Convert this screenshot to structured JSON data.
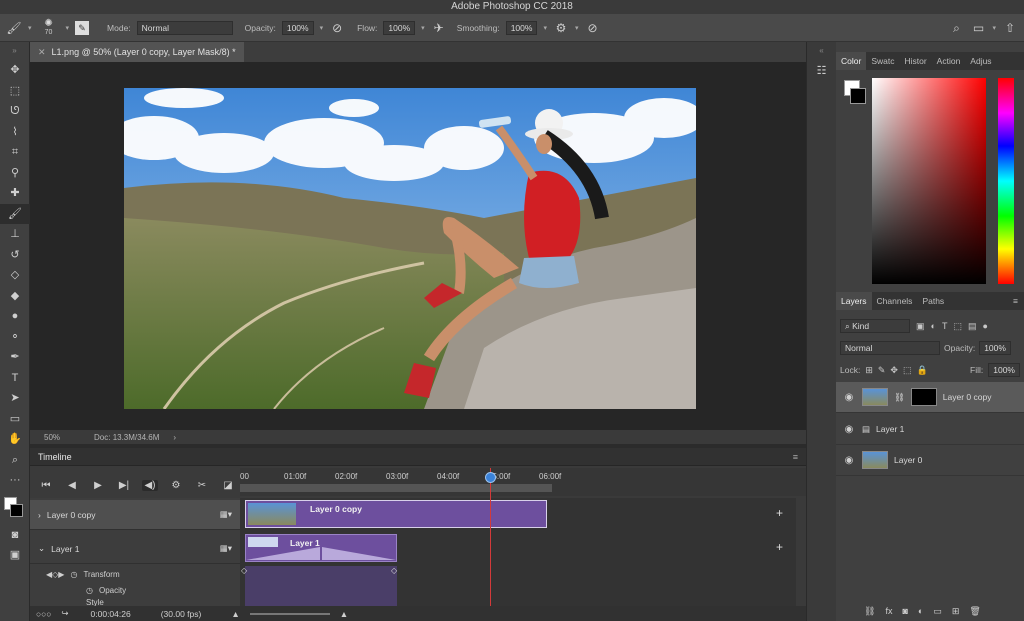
{
  "app": {
    "title": "Adobe Photoshop CC 2018"
  },
  "options": {
    "brush_size": "70",
    "mode_label": "Mode:",
    "mode_value": "Normal",
    "opacity_label": "Opacity:",
    "opacity_value": "100%",
    "flow_label": "Flow:",
    "flow_value": "100%",
    "smoothing_label": "Smoothing:",
    "smoothing_value": "100%"
  },
  "document": {
    "tab_title": "L1.png @ 50% (Layer 0 copy, Layer Mask/8) *",
    "zoom": "50%",
    "doc_size": "Doc: 13.3M/34.6M"
  },
  "timeline": {
    "title": "Timeline",
    "ruler": [
      "00",
      "01:00f",
      "02:00f",
      "03:00f",
      "04:00f",
      "05:00f",
      "06:00f"
    ],
    "tracks": [
      {
        "name": "Layer 0 copy",
        "clip": "Layer 0 copy"
      },
      {
        "name": "Layer 1",
        "clip": "Layer 1"
      }
    ],
    "sub_tracks": [
      "Transform",
      "Opacity",
      "Style"
    ],
    "timecode": "0:00:04:26",
    "fps": "(30.00 fps)",
    "playhead_seconds": 5.0
  },
  "panels": {
    "color_tabs": [
      "Color",
      "Swatc",
      "Histor",
      "Action",
      "Adjus"
    ],
    "layer_tabs": [
      "Layers",
      "Channels",
      "Paths"
    ],
    "kind_label": "Kind",
    "blend_mode": "Normal",
    "opacity_label": "Opacity:",
    "opacity_value": "100%",
    "lock_label": "Lock:",
    "fill_label": "Fill:",
    "fill_value": "100%",
    "layers": [
      {
        "name": "Layer 0 copy",
        "selected": true
      },
      {
        "name": "Layer 1",
        "selected": false
      },
      {
        "name": "Layer 0",
        "selected": false
      }
    ]
  }
}
